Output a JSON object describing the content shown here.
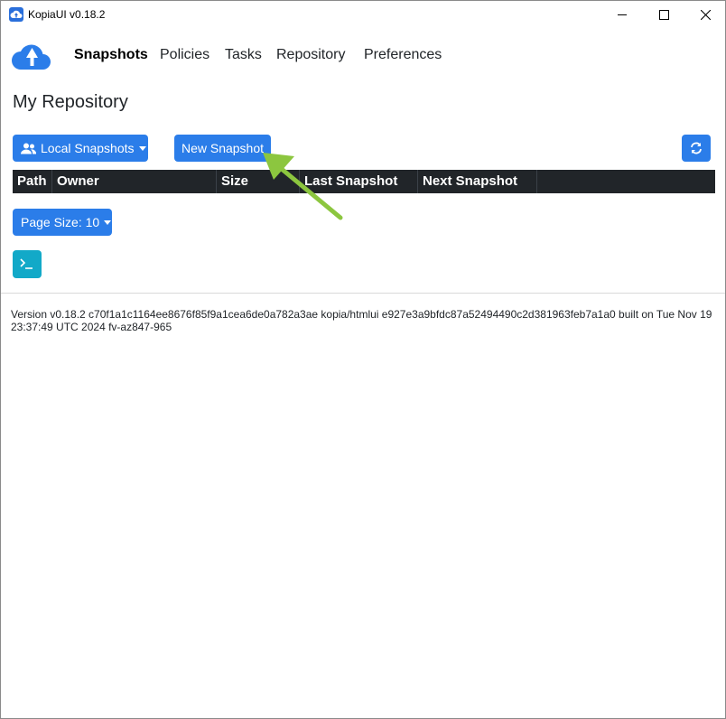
{
  "window": {
    "title": "KopiaUI v0.18.2"
  },
  "nav": {
    "items": [
      {
        "label": "Snapshots",
        "active": true
      },
      {
        "label": "Policies",
        "active": false
      },
      {
        "label": "Tasks",
        "active": false
      },
      {
        "label": "Repository",
        "active": false
      },
      {
        "label": "Preferences",
        "active": false
      }
    ]
  },
  "page": {
    "title": "My Repository"
  },
  "toolbar": {
    "local_snapshots_label": "Local Snapshots",
    "new_snapshot_label": "New Snapshot",
    "refresh_icon": "refresh-icon"
  },
  "table": {
    "columns": [
      "Path",
      "Owner",
      "Size",
      "Last Snapshot",
      "Next Snapshot"
    ]
  },
  "pager": {
    "page_size_label": "Page Size: 10"
  },
  "footer": {
    "version_text": "Version v0.18.2 c70f1a1c1164ee8676f85f9a1cea6de0a782a3ae kopia/htmlui e927e3a9bfdc87a52494490c2d381963feb7a1a0 built on Tue Nov 19 23:37:49 UTC 2024 fv-az847-965"
  },
  "colors": {
    "primary": "#2b7de9",
    "table_header": "#212529",
    "terminal": "#12a9c8",
    "annotation_arrow": "#8cc63f"
  }
}
